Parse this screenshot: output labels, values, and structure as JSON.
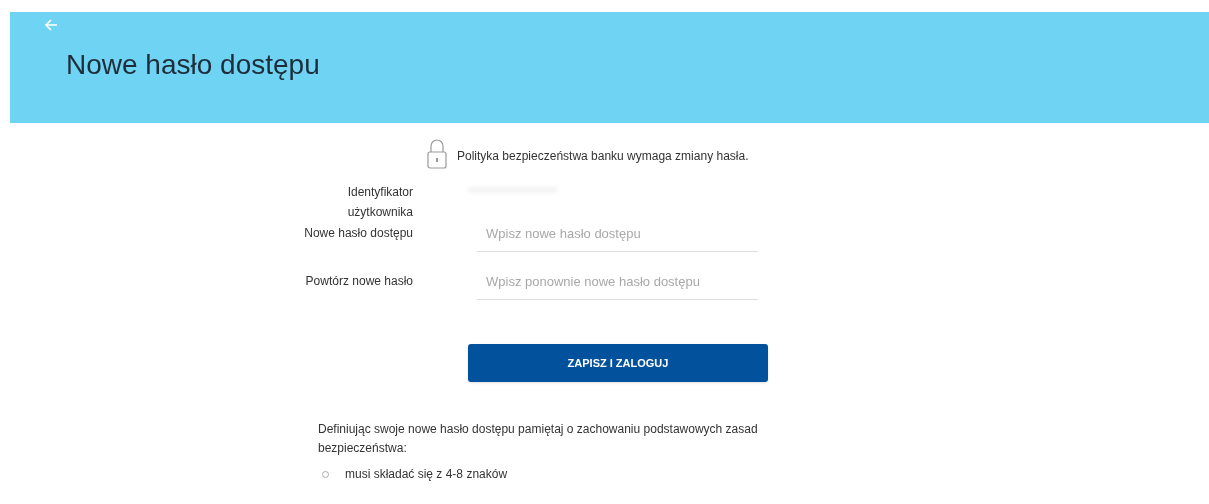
{
  "header": {
    "title": "Nowe hasło dostępu"
  },
  "notice": {
    "text": "Polityka bezpieczeństwa banku wymaga zmiany hasła."
  },
  "form": {
    "fields": [
      {
        "kind": "readonly",
        "label": "Identyfikator użytkownika"
      },
      {
        "kind": "input",
        "label": "Nowe hasło dostępu",
        "placeholder": "Wpisz nowe hasło dostępu"
      },
      {
        "kind": "input",
        "label": "Powtórz nowe hasło",
        "placeholder": "Wpisz ponownie nowe hasło dostępu"
      }
    ],
    "submit": "ZAPISZ I ZALOGUJ"
  },
  "rules": {
    "intro": "Definiując swoje nowe hasło dostępu pamiętaj o zachowaniu podstawowych zasad bezpieczeństwa:",
    "items": [
      "musi składać się z 4-8 znaków"
    ]
  }
}
